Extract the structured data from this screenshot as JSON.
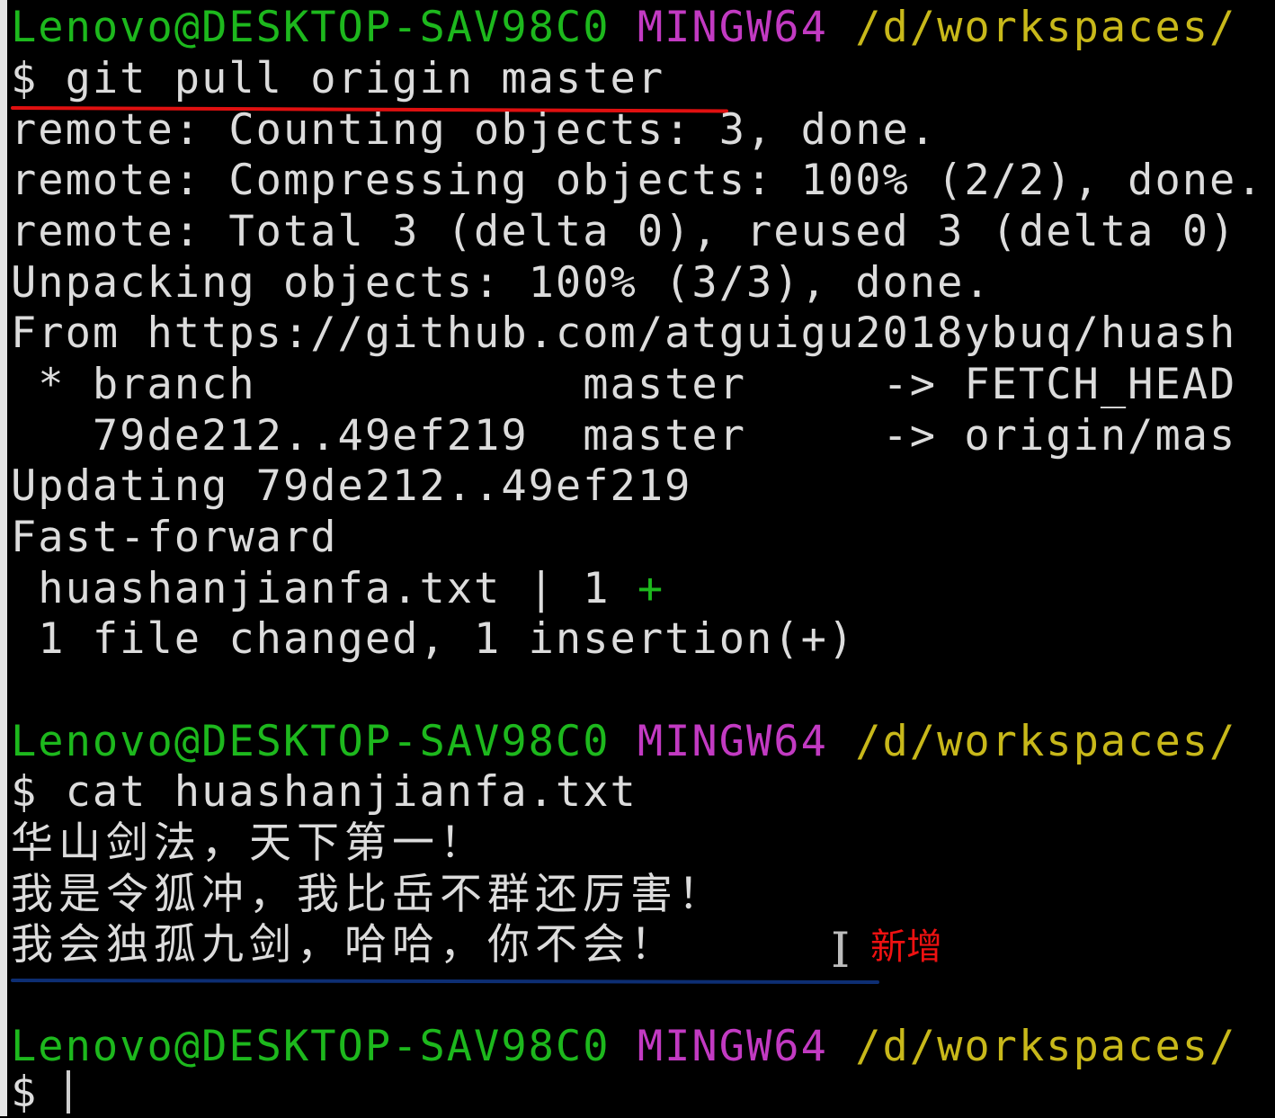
{
  "terminal": {
    "prompt": {
      "user": "Lenovo@DESKTOP-SAV98C0",
      "shell": "MINGW64",
      "path": "/d/workspaces/"
    },
    "commands": {
      "pull": "$ git pull origin master",
      "cat": "$ cat huashanjianfa.txt",
      "empty": "$ "
    },
    "pull_output": [
      "remote: Counting objects: 3, done.",
      "remote: Compressing objects: 100% (2/2), done.",
      "remote: Total 3 (delta 0), reused 3 (delta 0)",
      "Unpacking objects: 100% (3/3), done.",
      "From https://github.com/atguigu2018ybuq/huash",
      " * branch            master     -> FETCH_HEAD",
      "   79de212..49ef219  master     -> origin/mas",
      "Updating 79de212..49ef219",
      "Fast-forward"
    ],
    "diffstat": {
      "file": " huashanjianfa.txt | 1 ",
      "plus": "+",
      "summary": " 1 file changed, 1 insertion(+)"
    },
    "file_lines": [
      "华山剑法，天下第一！",
      "我是令狐冲，我比岳不群还厉害！",
      "我会独孤九剑，哈哈，你不会！"
    ]
  },
  "annotation": {
    "label": "新增",
    "underline_red": "#e01010",
    "underline_blue": "#0d2e73"
  },
  "colors": {
    "background": "#000000",
    "text": "#dcdcdc",
    "user": "#1db81d",
    "shell": "#c23ac2",
    "path": "#c8b81a"
  },
  "icons": {
    "text_cursor": "i-beam-icon"
  }
}
